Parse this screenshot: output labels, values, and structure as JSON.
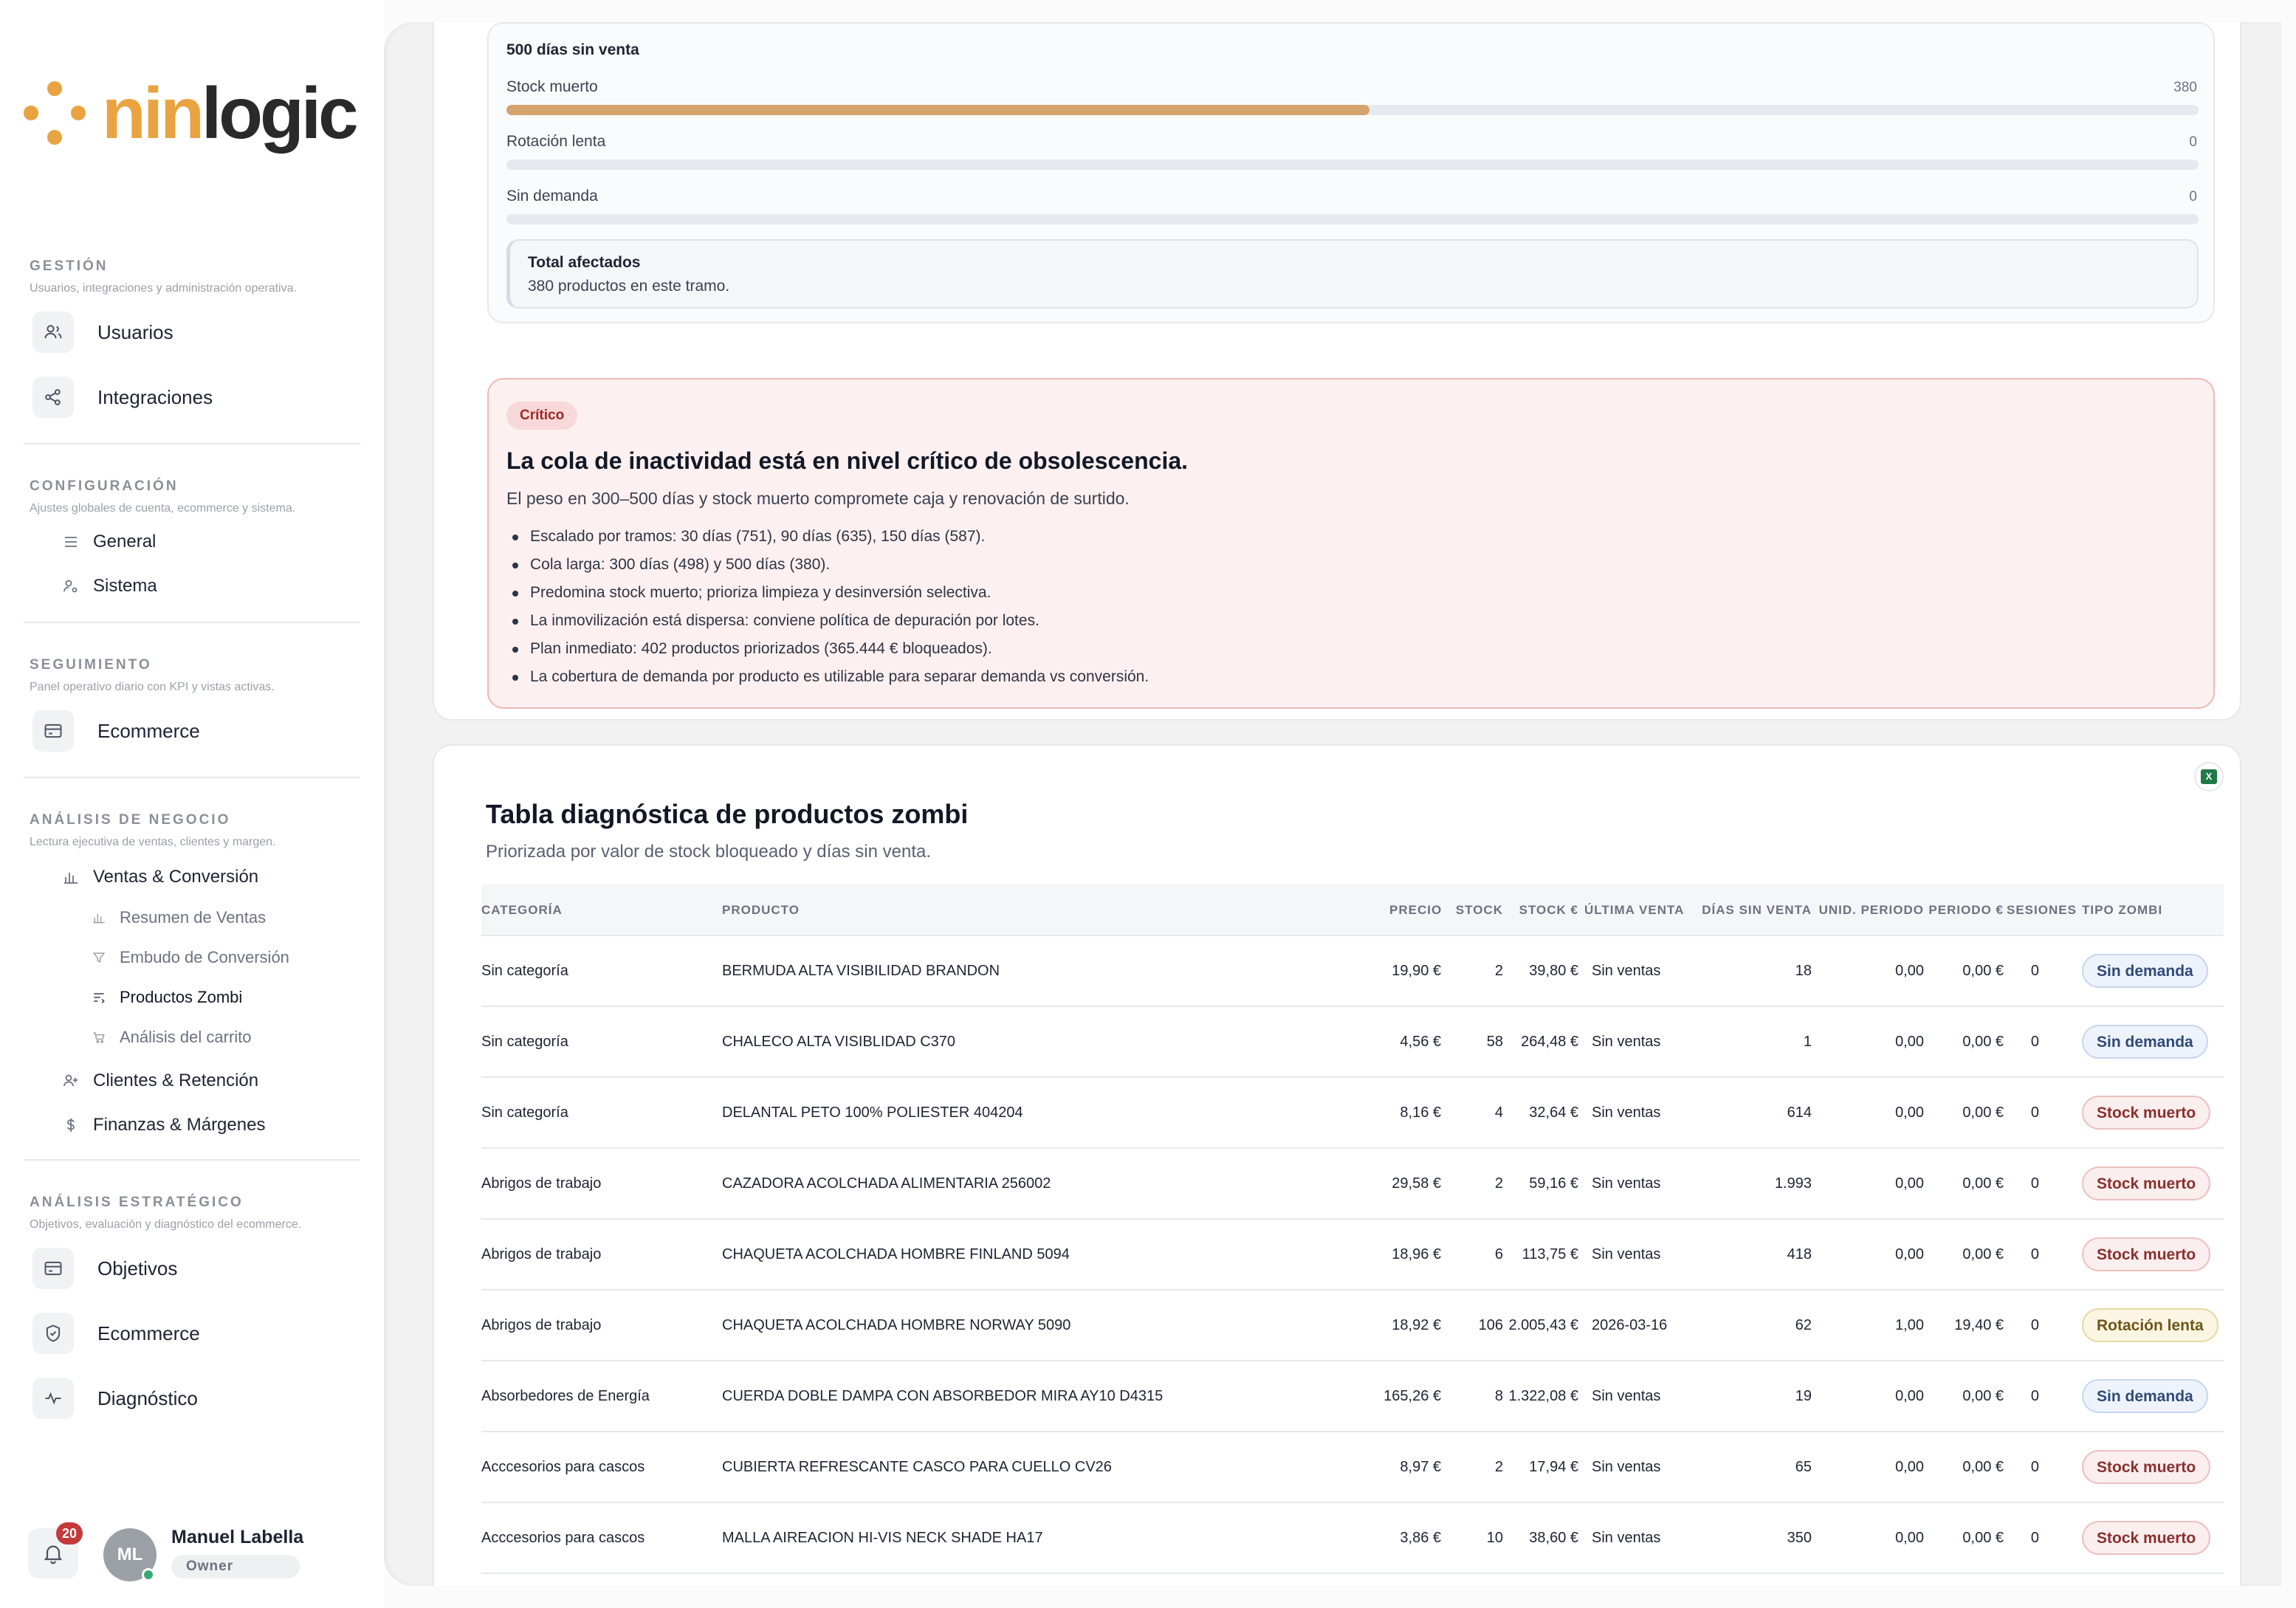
{
  "brand": {
    "logo_a": "nin",
    "logo_b": "logic"
  },
  "sidebar": {
    "gestion": {
      "title": "GESTIÓN",
      "subtitle": "Usuarios, integraciones y administración operativa.",
      "items": [
        {
          "label": "Usuarios"
        },
        {
          "label": "Integraciones"
        }
      ]
    },
    "configuracion": {
      "title": "CONFIGURACIÓN",
      "subtitle": "Ajustes globales de cuenta, ecommerce y sistema.",
      "items": [
        {
          "label": "General"
        },
        {
          "label": "Sistema"
        }
      ]
    },
    "seguimiento": {
      "title": "SEGUIMIENTO",
      "subtitle": "Panel operativo diario con KPI y vistas activas.",
      "items": [
        {
          "label": "Ecommerce"
        }
      ]
    },
    "negocio": {
      "title": "ANÁLISIS DE NEGOCIO",
      "subtitle": "Lectura ejecutiva de ventas, clientes y margen.",
      "ventas": "Ventas & Conversión",
      "sub_items": [
        {
          "label": "Resumen de Ventas"
        },
        {
          "label": "Embudo de Conversión"
        },
        {
          "label": "Productos Zombi"
        },
        {
          "label": "Análisis del carrito"
        }
      ],
      "clientes": "Clientes & Retención",
      "finanzas": "Finanzas & Márgenes"
    },
    "estrategico": {
      "title": "ANÁLISIS ESTRATÉGICO",
      "subtitle": "Objetivos, evaluación y diagnóstico del ecommerce.",
      "items": [
        {
          "label": "Objetivos"
        },
        {
          "label": "Ecommerce"
        },
        {
          "label": "Diagnóstico"
        }
      ]
    }
  },
  "user": {
    "notifications": "20",
    "initials": "ML",
    "name": "Manuel Labella",
    "role": "Owner"
  },
  "tramo": {
    "title": "500 días sin venta",
    "bars": [
      {
        "label": "Stock muerto",
        "value": "380",
        "fill": 0.51
      },
      {
        "label": "Rotación lenta",
        "value": "0",
        "fill": 0
      },
      {
        "label": "Sin demanda",
        "value": "0",
        "fill": 0
      }
    ],
    "total_title": "Total afectados",
    "total_sub": "380 productos en este tramo."
  },
  "alert": {
    "badge": "Crítico",
    "title": "La cola de inactividad está en nivel crítico de obsolescencia.",
    "subtitle": "El peso en 300–500 días y stock muerto compromete caja y renovación de surtido.",
    "items": [
      "Escalado por tramos: 30 días (751), 90 días (635), 150 días (587).",
      "Cola larga: 300 días (498) y 500 días (380).",
      "Predomina stock muerto; prioriza limpieza y desinversión selectiva.",
      "La inmovilización está dispersa: conviene política de depuración por lotes.",
      "Plan inmediato: 402 productos priorizados (365.444 € bloqueados).",
      "La cobertura de demanda por producto es utilizable para separar demanda vs conversión."
    ]
  },
  "table": {
    "title": "Tabla diagnóstica de productos zombi",
    "subtitle": "Priorizada por valor de stock bloqueado y días sin venta.",
    "export_label": "X",
    "columns": {
      "categoria": "CATEGORÍA",
      "producto": "PRODUCTO",
      "precio": "PRECIO",
      "stock": "STOCK",
      "stock_eur": "STOCK €",
      "ultima": "ÚLTIMA VENTA",
      "dias": "DÍAS SIN VENTA",
      "unid": "UNID. PERIODO",
      "periodo": "PERIODO €",
      "sesiones": "SESIONES",
      "tipo": "TIPO ZOMBI"
    },
    "rows": [
      {
        "categoria": "Sin categoría",
        "producto": "BERMUDA ALTA VISIBILIDAD BRANDON",
        "precio": "19,90 €",
        "stock": "2",
        "stock_eur": "39,80 €",
        "ultima": "Sin ventas",
        "dias": "18",
        "unid": "0,00",
        "periodo": "0,00 €",
        "sesiones": "0",
        "tipo": "Sin demanda",
        "tipo_class": "demanda"
      },
      {
        "categoria": "Sin categoría",
        "producto": "CHALECO ALTA VISIBLIDAD C370",
        "precio": "4,56 €",
        "stock": "58",
        "stock_eur": "264,48 €",
        "ultima": "Sin ventas",
        "dias": "1",
        "unid": "0,00",
        "periodo": "0,00 €",
        "sesiones": "0",
        "tipo": "Sin demanda",
        "tipo_class": "demanda"
      },
      {
        "categoria": "Sin categoría",
        "producto": "DELANTAL PETO 100% POLIESTER 404204",
        "precio": "8,16 €",
        "stock": "4",
        "stock_eur": "32,64 €",
        "ultima": "Sin ventas",
        "dias": "614",
        "unid": "0,00",
        "periodo": "0,00 €",
        "sesiones": "0",
        "tipo": "Stock muerto",
        "tipo_class": "muerto"
      },
      {
        "categoria": "Abrigos de trabajo",
        "producto": "CAZADORA ACOLCHADA ALIMENTARIA 256002",
        "precio": "29,58 €",
        "stock": "2",
        "stock_eur": "59,16 €",
        "ultima": "Sin ventas",
        "dias": "1.993",
        "unid": "0,00",
        "periodo": "0,00 €",
        "sesiones": "0",
        "tipo": "Stock muerto",
        "tipo_class": "muerto"
      },
      {
        "categoria": "Abrigos de trabajo",
        "producto": "CHAQUETA ACOLCHADA HOMBRE FINLAND 5094",
        "precio": "18,96 €",
        "stock": "6",
        "stock_eur": "113,75 €",
        "ultima": "Sin ventas",
        "dias": "418",
        "unid": "0,00",
        "periodo": "0,00 €",
        "sesiones": "0",
        "tipo": "Stock muerto",
        "tipo_class": "muerto"
      },
      {
        "categoria": "Abrigos de trabajo",
        "producto": "CHAQUETA ACOLCHADA HOMBRE NORWAY 5090",
        "precio": "18,92 €",
        "stock": "106",
        "stock_eur": "2.005,43 €",
        "ultima": "2026-03-16",
        "dias": "62",
        "unid": "1,00",
        "periodo": "19,40 €",
        "sesiones": "0",
        "tipo": "Rotación lenta",
        "tipo_class": "lenta"
      },
      {
        "categoria": "Absorbedores de Energía",
        "producto": "CUERDA DOBLE DAMPA CON ABSORBEDOR MIRA AY10 D4315",
        "precio": "165,26 €",
        "stock": "8",
        "stock_eur": "1.322,08 €",
        "ultima": "Sin ventas",
        "dias": "19",
        "unid": "0,00",
        "periodo": "0,00 €",
        "sesiones": "0",
        "tipo": "Sin demanda",
        "tipo_class": "demanda"
      },
      {
        "categoria": "Acccesorios para cascos",
        "producto": "CUBIERTA REFRESCANTE CASCO PARA CUELLO CV26",
        "precio": "8,97 €",
        "stock": "2",
        "stock_eur": "17,94 €",
        "ultima": "Sin ventas",
        "dias": "65",
        "unid": "0,00",
        "periodo": "0,00 €",
        "sesiones": "0",
        "tipo": "Stock muerto",
        "tipo_class": "muerto"
      },
      {
        "categoria": "Acccesorios para cascos",
        "producto": "MALLA AIREACION HI-VIS NECK SHADE HA17",
        "precio": "3,86 €",
        "stock": "10",
        "stock_eur": "38,60 €",
        "ultima": "Sin ventas",
        "dias": "350",
        "unid": "0,00",
        "periodo": "0,00 €",
        "sesiones": "0",
        "tipo": "Stock muerto",
        "tipo_class": "muerto"
      }
    ]
  }
}
